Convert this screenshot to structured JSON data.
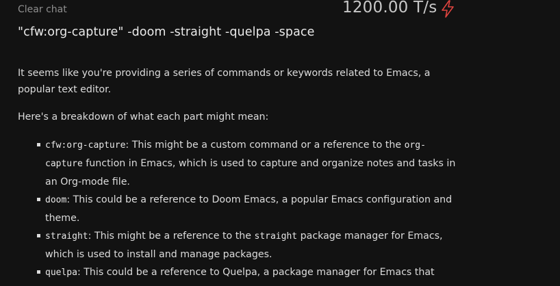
{
  "header": {
    "clear_chat_label": "Clear chat",
    "speed_value": "1200.00 T/s",
    "speed_icon": "lightning-bolt-icon",
    "accent_color": "#e0443f"
  },
  "prompt": {
    "text": "\"cfw:org-capture\" -doom -straight -quelpa -space"
  },
  "response": {
    "intro": "It seems like you're providing a series of commands or keywords related to Emacs, a popular text editor.",
    "breakdown_heading": "Here's a breakdown of what each part might mean:",
    "items": [
      {
        "code": "cfw:org-capture",
        "text_a": ": This might be a custom command or a reference to the ",
        "code_b": "org-capture",
        "text_b": " function in Emacs, which is used to capture and organize notes and tasks in an Org-mode file."
      },
      {
        "code": "doom",
        "text_a": ": This could be a reference to Doom Emacs, a popular Emacs configuration and theme."
      },
      {
        "code": "straight",
        "text_a": ": This might be a reference to the ",
        "code_b": "straight",
        "text_b": " package manager for Emacs, which is used to install and manage packages."
      },
      {
        "code": "quelpa",
        "text_a": ": This could be a reference to Quelpa, a package manager for Emacs that allows you to easily install and manage packages."
      }
    ]
  }
}
